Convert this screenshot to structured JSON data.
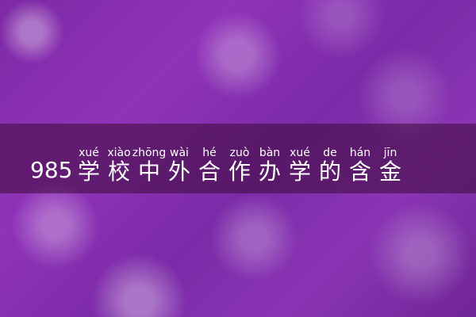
{
  "title": {
    "prefix": "985",
    "chars": [
      {
        "pinyin": "xué",
        "han": "学"
      },
      {
        "pinyin": "xiào",
        "han": "校"
      },
      {
        "pinyin": "zhōng",
        "han": "中"
      },
      {
        "pinyin": "wài",
        "han": "外"
      },
      {
        "pinyin": "hé",
        "han": "合"
      },
      {
        "pinyin": "zuò",
        "han": "作"
      },
      {
        "pinyin": "bàn",
        "han": "办"
      },
      {
        "pinyin": "xué",
        "han": "学"
      },
      {
        "pinyin": "de",
        "han": "的"
      },
      {
        "pinyin": "hán",
        "han": "含"
      },
      {
        "pinyin": "jīn",
        "han": "金"
      }
    ]
  },
  "colors": {
    "background": "#8a35b4",
    "band": "#3c0a37",
    "text": "#ffffff"
  }
}
